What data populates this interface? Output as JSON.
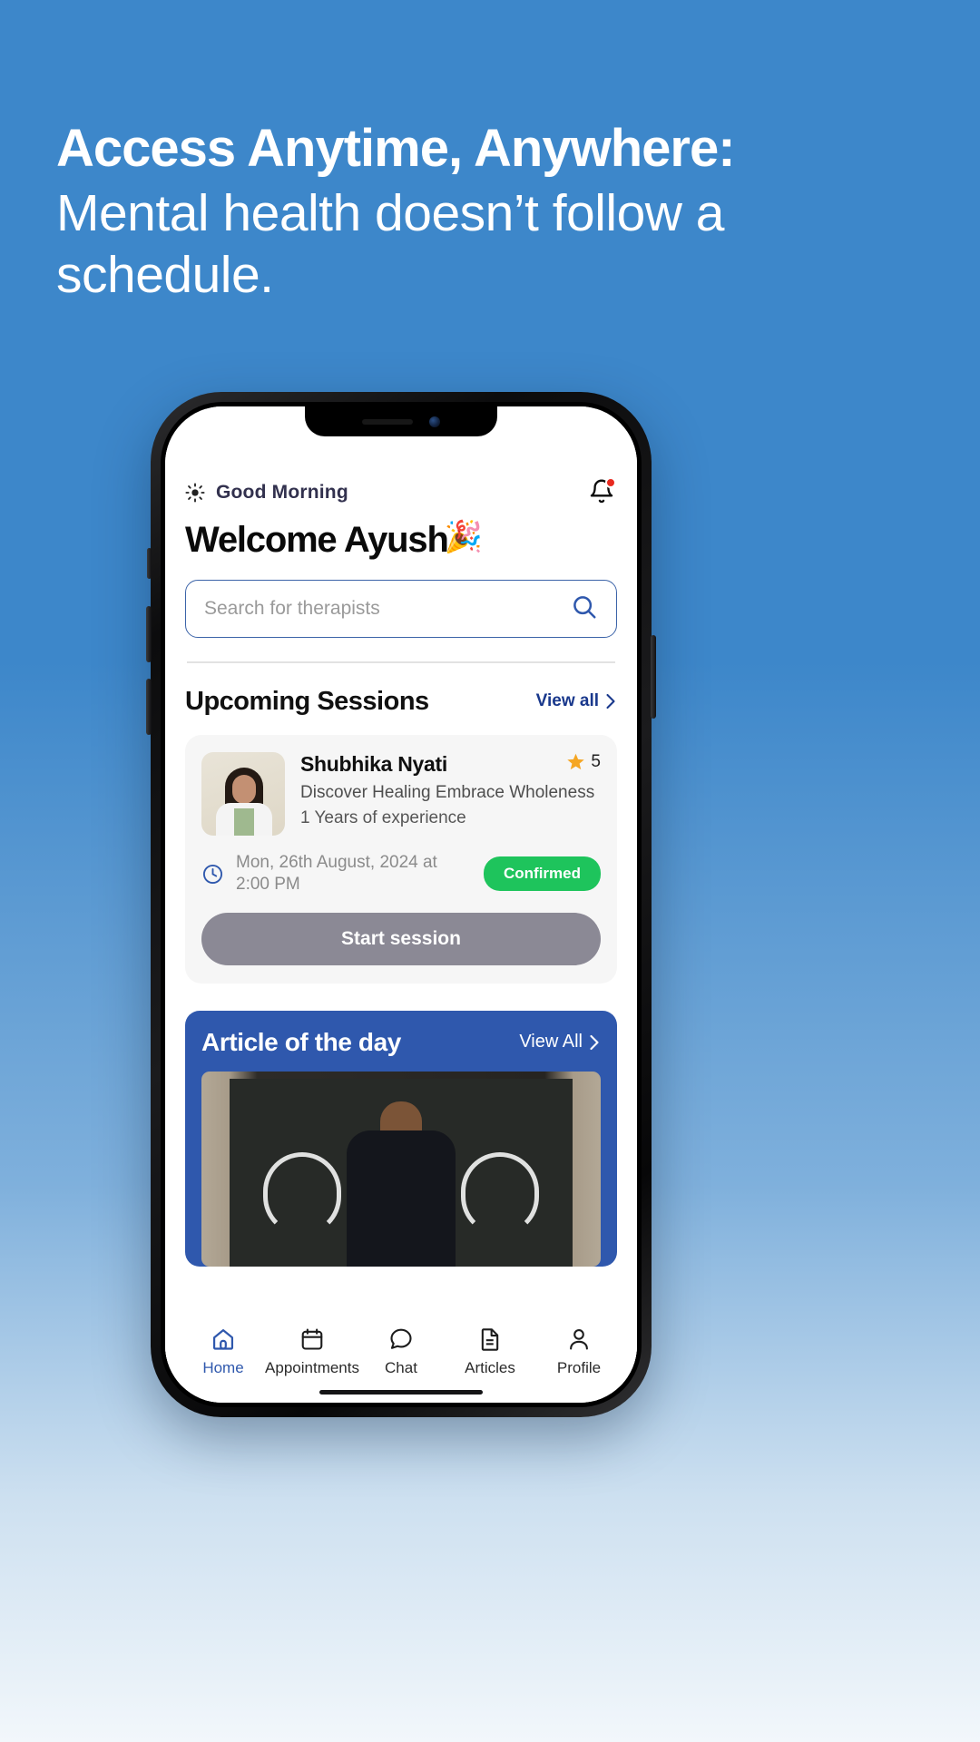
{
  "banner": {
    "headline": "Access Anytime, Anywhere:",
    "subline": "Mental health doesn’t follow a schedule.",
    "background_color": "#3d87ca",
    "text_color": "#ffffff"
  },
  "app": {
    "header": {
      "greeting": "Good Morning",
      "sun_icon": "sun-icon",
      "notification_icon": "bell-icon",
      "notification_badge": "",
      "welcome": "Welcome Ayush",
      "welcome_emoji": "🎉"
    },
    "search": {
      "placeholder": "Search for therapists",
      "value": "",
      "icon": "search-icon"
    },
    "upcoming": {
      "title": "Upcoming Sessions",
      "view_all": "View all",
      "chevron": "›",
      "session": {
        "therapist_name": "Shubhika Nyati",
        "rating": "5",
        "rating_icon": "star-icon",
        "tagline": "Discover Healing Embrace Wholeness",
        "experience": "1 Years of experience",
        "datetime": "Mon, 26th August, 2024 at 2:00 PM",
        "clock_icon": "clock-icon",
        "status": "Confirmed",
        "status_color": "#1ec45c",
        "action_label": "Start session",
        "action_color": "#8b8995"
      }
    },
    "article": {
      "title": "Article of the day",
      "view_all": "View All",
      "chevron": "›",
      "card_color": "#2f58ad"
    },
    "nav": {
      "items": [
        {
          "label": "Home",
          "icon": "home-icon",
          "active": true
        },
        {
          "label": "Appointments",
          "icon": "calendar-icon",
          "active": false
        },
        {
          "label": "Chat",
          "icon": "chat-icon",
          "active": false
        },
        {
          "label": "Articles",
          "icon": "document-icon",
          "active": false
        },
        {
          "label": "Profile",
          "icon": "person-icon",
          "active": false
        }
      ]
    }
  }
}
